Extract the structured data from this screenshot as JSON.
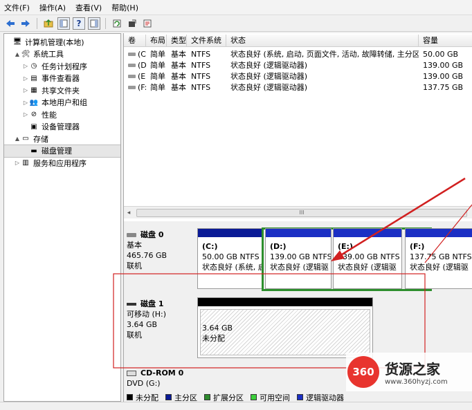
{
  "menu": [
    "文件(F)",
    "操作(A)",
    "查看(V)",
    "帮助(H)"
  ],
  "toolbar": [
    "back-arrow-icon",
    "forward-arrow-icon",
    "folder-up-icon",
    "console-tree-icon",
    "help-icon",
    "console-tree-icon-2",
    "refresh-icon",
    "export-icon",
    "properties-icon"
  ],
  "tree": [
    {
      "label": "计算机管理(本地)",
      "level": 0,
      "tri": "",
      "icon": "computer-icon",
      "sel": false
    },
    {
      "label": "系统工具",
      "level": 1,
      "tri": "▲",
      "icon": "tools-icon",
      "sel": false
    },
    {
      "label": "任务计划程序",
      "level": 2,
      "tri": "▷",
      "icon": "clock-icon",
      "sel": false
    },
    {
      "label": "事件查看器",
      "level": 2,
      "tri": "▷",
      "icon": "event-icon",
      "sel": false
    },
    {
      "label": "共享文件夹",
      "level": 2,
      "tri": "▷",
      "icon": "share-icon",
      "sel": false
    },
    {
      "label": "本地用户和组",
      "level": 2,
      "tri": "▷",
      "icon": "users-icon",
      "sel": false
    },
    {
      "label": "性能",
      "level": 2,
      "tri": "▷",
      "icon": "perf-icon",
      "sel": false
    },
    {
      "label": "设备管理器",
      "level": 2,
      "tri": "",
      "icon": "device-icon",
      "sel": false
    },
    {
      "label": "存储",
      "level": 1,
      "tri": "▲",
      "icon": "storage-icon",
      "sel": false
    },
    {
      "label": "磁盘管理",
      "level": 2,
      "tri": "",
      "icon": "disk-mgmt-icon",
      "sel": true
    },
    {
      "label": "服务和应用程序",
      "level": 1,
      "tri": "▷",
      "icon": "services-icon",
      "sel": false
    }
  ],
  "volume_table": {
    "headers": [
      "卷",
      "布局",
      "类型",
      "文件系统",
      "状态",
      "容量"
    ],
    "rows": [
      [
        "(C:)",
        "简单",
        "基本",
        "NTFS",
        "状态良好 (系统, 启动, 页面文件, 活动, 故障转储, 主分区)",
        "50.00 GB"
      ],
      [
        "(D:)",
        "简单",
        "基本",
        "NTFS",
        "状态良好 (逻辑驱动器)",
        "139.00 GB"
      ],
      [
        "(E:)",
        "简单",
        "基本",
        "NTFS",
        "状态良好 (逻辑驱动器)",
        "139.00 GB"
      ],
      [
        "(F:)",
        "简单",
        "基本",
        "NTFS",
        "状态良好 (逻辑驱动器)",
        "137.75 GB"
      ]
    ],
    "scroll_thumb": "III"
  },
  "disks": [
    {
      "name": "磁盘 0",
      "type": "基本",
      "size": "465.76 GB",
      "state": "联机",
      "parts": [
        {
          "label": "(C:)",
          "size": "50.00 GB NTFS",
          "status": "状态良好 (系统, 启"
        },
        {
          "label": "(D:)",
          "size": "139.00 GB NTFS",
          "status": "状态良好 (逻辑驱"
        },
        {
          "label": "(E:)",
          "size": "139.00 GB NTFS",
          "status": "状态良好 (逻辑驱"
        },
        {
          "label": "(F:)",
          "size": "137.75 GB NTFS",
          "status": "状态良好 (逻辑驱"
        }
      ]
    },
    {
      "name": "磁盘 1",
      "type": "可移动 (H:)",
      "size": "3.64 GB",
      "state": "联机",
      "parts": [
        {
          "label": "",
          "size": "3.64 GB",
          "status": "未分配"
        }
      ]
    },
    {
      "name": "CD-ROM 0",
      "type": "DVD (G:)",
      "size": "",
      "state": "",
      "parts": []
    }
  ],
  "legend": [
    {
      "label": "未分配",
      "color": "#000000"
    },
    {
      "label": "主分区",
      "color": "#0a1a96"
    },
    {
      "label": "扩展分区",
      "color": "#2e8b2e"
    },
    {
      "label": "可用空间",
      "color": "#3ccf3c"
    },
    {
      "label": "逻辑驱动器",
      "color": "#1b2fc4"
    }
  ],
  "watermark": {
    "logo": "360",
    "text": "货源之家",
    "url": "www.360hyzj.com"
  }
}
